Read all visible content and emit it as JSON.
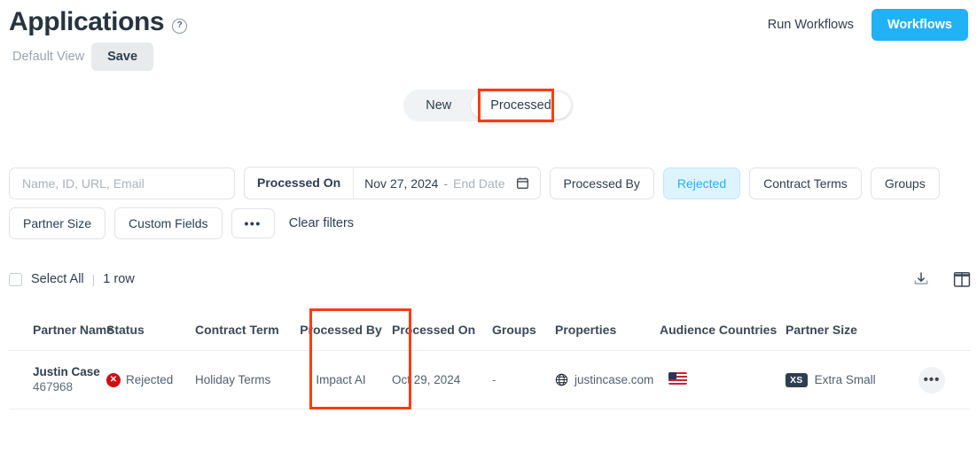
{
  "header": {
    "title": "Applications",
    "help_icon": "question-mark-icon",
    "default_view_label": "Default View",
    "save_label": "Save",
    "run_workflows_label": "Run Workflows",
    "workflows_label": "Workflows",
    "accent_color": "#21b2f5"
  },
  "tabs": [
    {
      "label": "New",
      "active": false
    },
    {
      "label": "Processed",
      "active": true
    }
  ],
  "annotations": {
    "color": "#fa3c10",
    "boxes": [
      {
        "name": "processed-tab-highlight"
      },
      {
        "name": "processed-by-column-highlight"
      }
    ]
  },
  "filters": {
    "search": {
      "placeholder": "Name, ID, URL, Email",
      "value": ""
    },
    "date": {
      "label": "Processed On",
      "start": "Nov 27, 2024",
      "separator": "-",
      "end_placeholder": "End Date",
      "icon": "calendar-icon"
    },
    "pills": [
      {
        "label": "Processed By",
        "active": false
      },
      {
        "label": "Rejected",
        "active": true
      },
      {
        "label": "Contract Terms",
        "active": false
      },
      {
        "label": "Groups",
        "active": false
      },
      {
        "label": "Partner Size",
        "active": false
      },
      {
        "label": "Custom Fields",
        "active": false
      }
    ],
    "more_label": "•••",
    "clear_label": "Clear filters",
    "active_pill_color": "#21b2f5"
  },
  "toolbar": {
    "select_all_label": "Select All",
    "separator": "|",
    "row_count": "1 row",
    "download_icon": "download-icon",
    "columns_icon": "columns-layout-icon"
  },
  "table": {
    "columns": [
      "Partner Name",
      "Status",
      "Contract Term",
      "Processed By",
      "Processed On",
      "Groups",
      "Properties",
      "Audience Countries",
      "Partner Size"
    ],
    "rows": [
      {
        "partner_name": "Justin Case",
        "partner_id": "467968",
        "status": "Rejected",
        "status_icon": "error-circle-icon",
        "contract_term": "Holiday Terms",
        "processed_by": "Impact AI",
        "processed_on": "Oct 29, 2024",
        "groups": "-",
        "property_icon": "globe-icon",
        "property": "justincase.com",
        "audience_country_flag": "united-states-flag",
        "partner_size_badge": "XS",
        "partner_size": "Extra Small",
        "actions_icon": "kebab-menu-icon"
      }
    ]
  }
}
